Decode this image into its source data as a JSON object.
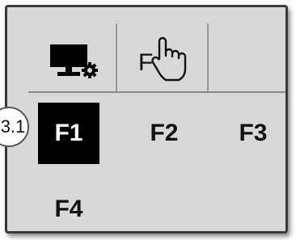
{
  "toolbar": {
    "items": [
      {
        "icon": "monitor-settings-icon"
      },
      {
        "icon": "function-touch-icon",
        "label": "F"
      },
      {
        "icon": "empty"
      }
    ]
  },
  "function_keys": [
    {
      "label": "F1",
      "selected": true
    },
    {
      "label": "F2",
      "selected": false
    },
    {
      "label": "F3",
      "selected": false
    },
    {
      "label": "F4",
      "selected": false
    }
  ],
  "callout": {
    "label": "3.1"
  },
  "colors": {
    "screen_bg": "#d8d8d8",
    "selected_bg": "#000000",
    "selected_fg": "#ffffff",
    "text": "#111111"
  }
}
